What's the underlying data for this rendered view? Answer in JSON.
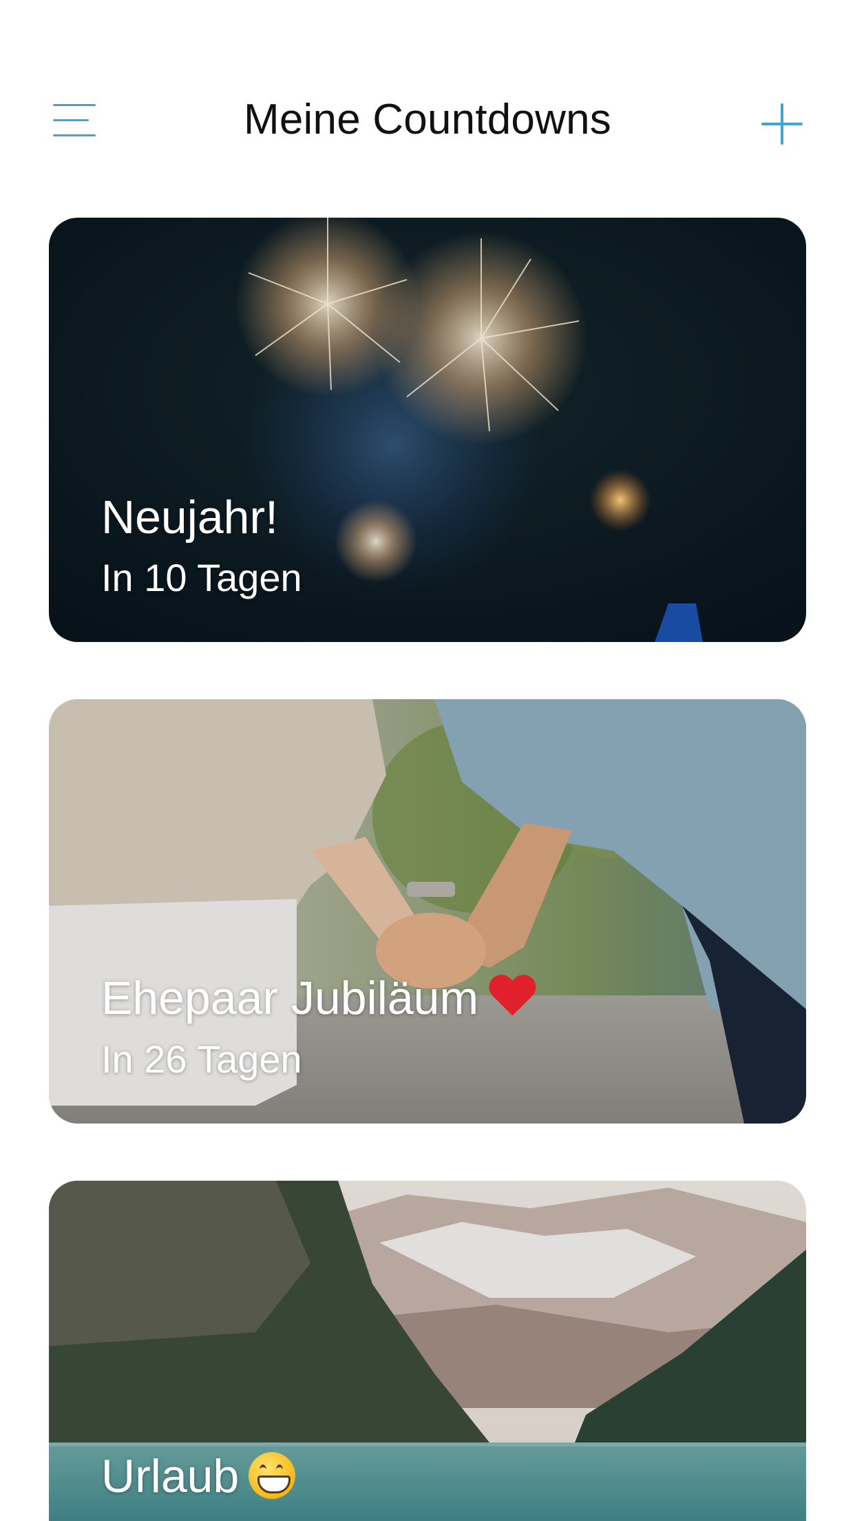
{
  "header": {
    "title": "Meine Countdowns",
    "menu_icon": "hamburger-menu-icon",
    "add_icon": "plus-icon",
    "accent_color": "#3ea6cf"
  },
  "countdowns": [
    {
      "title": "Neujahr!",
      "subtitle": "In 10 Tagen",
      "image": "fireworks-night-sky"
    },
    {
      "title": "Ehepaar Jubiläum",
      "title_emoji": "red-heart-emoji",
      "subtitle": "In 26 Tagen",
      "image": "couple-holding-hands"
    },
    {
      "title": "Urlaub",
      "title_emoji": "grinning-face-emoji",
      "image": "mountain-lake"
    }
  ]
}
